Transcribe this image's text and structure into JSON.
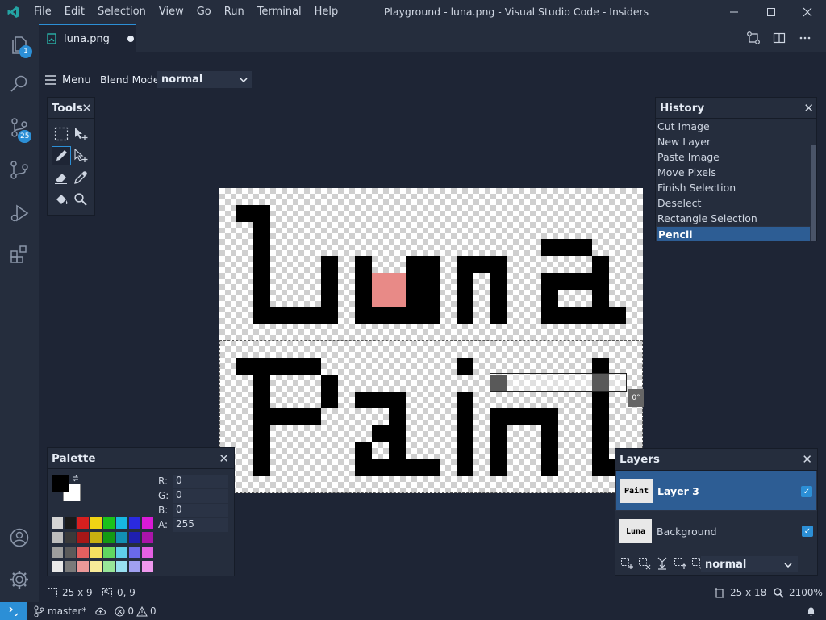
{
  "titlebar": {
    "menu": [
      "File",
      "Edit",
      "Selection",
      "View",
      "Go",
      "Run",
      "Terminal",
      "Help"
    ],
    "title": "Playground - luna.png - Visual Studio Code - Insiders"
  },
  "activity": {
    "explorer_badge": "1",
    "scm_badge": "25"
  },
  "tab": {
    "label": "luna.png"
  },
  "toolbar": {
    "menu_label": "Menu",
    "blend_label": "Blend Mode:",
    "blend_value": "normal"
  },
  "tools": {
    "title": "Tools"
  },
  "history": {
    "title": "History",
    "items": [
      "Cut Image",
      "New Layer",
      "Paste Image",
      "Move Pixels",
      "Finish Selection",
      "Deselect",
      "Rectangle Selection",
      "Pencil"
    ],
    "selected": 7
  },
  "canvas": {
    "rotation": "0°"
  },
  "palette": {
    "title": "Palette",
    "r_label": "R:",
    "r": "0",
    "g_label": "G:",
    "g": "0",
    "b_label": "B:",
    "b": "0",
    "a_label": "A:",
    "a": "255"
  },
  "layers": {
    "title": "Layers",
    "items": [
      {
        "name": "Layer 3",
        "thumb": "Paint",
        "checked": true
      },
      {
        "name": "Background",
        "thumb": "Luna",
        "checked": true
      }
    ],
    "blend_value": "normal"
  },
  "editor_status": {
    "selection_size": "25 x 9",
    "cursor": "0, 9",
    "image_size": "25 x 18",
    "zoom": "2100%"
  },
  "statusbar": {
    "branch": "master*",
    "errors": "0",
    "warnings": "0"
  },
  "colors": {
    "accent": "#2c8fd6",
    "selected": "#2d5d94",
    "pink": "#e88a87"
  }
}
